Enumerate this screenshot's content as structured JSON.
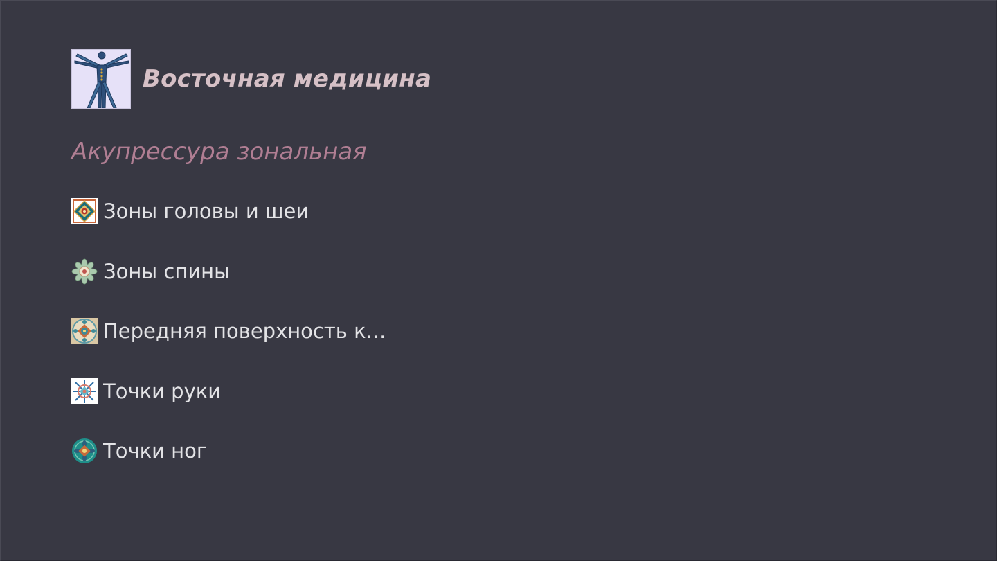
{
  "app": {
    "title": "Восточная медицина",
    "logo_icon": "vitruvian-body-icon"
  },
  "section": {
    "title": "Акупрессура зональная"
  },
  "menu": {
    "items": [
      {
        "label": "Зоны головы и шеи",
        "icon": "square-mandala-icon"
      },
      {
        "label": "Зоны спины",
        "icon": "lotus-mandala-icon"
      },
      {
        "label": "Передняя поверхность кор...",
        "icon": "ornate-mandala-icon"
      },
      {
        "label": "Точки руки",
        "icon": "snowflake-mandala-icon"
      },
      {
        "label": "Точки ног",
        "icon": "round-mandala-icon"
      }
    ]
  },
  "colors": {
    "background": "#383843",
    "app_title": "#d6c0c6",
    "section_title": "#b07e93",
    "menu_text": "#e3e3e6"
  }
}
